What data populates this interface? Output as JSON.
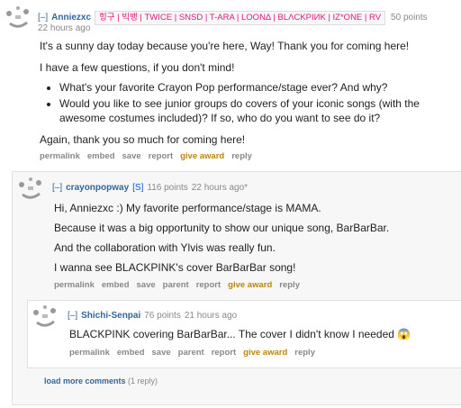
{
  "comment1": {
    "toggle": "[–]",
    "author": "Anniezxc",
    "flair": "힝구 | 빅뱅 | TWICE | SNSD | T-ARA | LOONΔ | BLΛCKPIИK | IZ*ONE | RV",
    "points": "50 points",
    "time": "22 hours ago",
    "para1": "It's a sunny day today because you're here, Way! Thank you for coming here!",
    "para2": "I have a few questions, if you don't mind!",
    "bullets": [
      "What's your favorite Crayon Pop performance/stage ever? And why?",
      "Would you like to see junior groups do covers of your iconic songs (with the awesome costumes included)? If so, who do you want to see do it?"
    ],
    "para3": "Again, thank you so much for coming here!",
    "buttons": [
      "permalink",
      "embed",
      "save",
      "report",
      "give award",
      "reply"
    ]
  },
  "comment2": {
    "toggle": "[–]",
    "author": "crayonpopway",
    "submitter_tag": "[S]",
    "points": "116 points",
    "time": "22 hours ago*",
    "lines": [
      "Hi, Anniezxc :) My favorite performance/stage is MAMA.",
      "Because it was a big opportunity to show our unique song, BarBarBar.",
      "And the collaboration with Ylvis was really fun.",
      "I wanna see BLACKPINK's cover BarBarBar song!"
    ],
    "buttons": [
      "permalink",
      "embed",
      "save",
      "parent",
      "report",
      "give award",
      "reply"
    ]
  },
  "comment3": {
    "toggle": "[–]",
    "author": "Shichi-Senpai",
    "points": "76 points",
    "time": "21 hours ago",
    "text": "BLACKPINK covering BarBarBar... The cover I didn't know I needed",
    "emoji": "😱",
    "buttons": [
      "permalink",
      "embed",
      "save",
      "parent",
      "report",
      "give award",
      "reply"
    ]
  },
  "load_more": {
    "label": "load more comments",
    "count": "(1 reply)"
  },
  "colors": {
    "link": "#336699",
    "award": "#b8860b",
    "flair_text": "#e0177a",
    "meta": "#888888"
  }
}
